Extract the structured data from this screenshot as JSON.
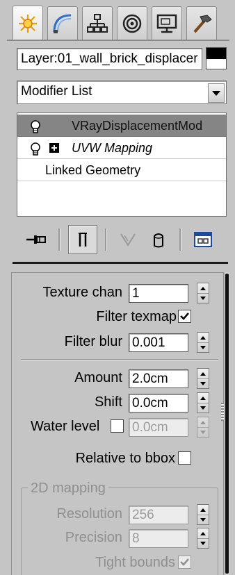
{
  "tabs": [
    {
      "name": "create-tab",
      "icon": "sun-icon",
      "active": true
    },
    {
      "name": "modify-tab",
      "icon": "modify-curve-icon",
      "active": false
    },
    {
      "name": "hierarchy-tab",
      "icon": "hierarchy-icon",
      "active": false
    },
    {
      "name": "motion-tab",
      "icon": "motion-circle-icon",
      "active": false
    },
    {
      "name": "display-tab",
      "icon": "monitor-icon",
      "active": false
    },
    {
      "name": "utilities-tab",
      "icon": "hammer-icon",
      "active": false
    }
  ],
  "object_name": "Layer:01_wall_brick_displacer",
  "object_color": "#000000",
  "modifier_list": {
    "selected": "Modifier List"
  },
  "modifier_stack": {
    "items": [
      {
        "label": "VRayDisplacementMod",
        "selected": true,
        "has_bulb": true,
        "expandable": false,
        "italic": false
      },
      {
        "label": "UVW Mapping",
        "selected": false,
        "has_bulb": true,
        "expandable": true,
        "italic": true
      },
      {
        "label": "Linked Geometry",
        "selected": false,
        "has_bulb": false,
        "expandable": false,
        "italic": false
      }
    ]
  },
  "stack_tools": [
    {
      "name": "pin-stack-button",
      "icon": "pin-icon"
    },
    {
      "name": "show-end-result-button",
      "icon": "end-result-icon"
    },
    {
      "name": "make-unique-button",
      "icon": "make-unique-icon"
    },
    {
      "name": "remove-modifier-button",
      "icon": "remove-modifier-icon"
    },
    {
      "name": "configure-modifier-sets-button",
      "icon": "configure-sets-icon"
    }
  ],
  "params": {
    "texture_chan": {
      "label": "Texture chan",
      "value": "1"
    },
    "filter_texmap": {
      "label": "Filter texmap",
      "checked": true
    },
    "filter_blur": {
      "label": "Filter blur",
      "value": "0.001"
    },
    "amount": {
      "label": "Amount",
      "value": "2.0cm"
    },
    "shift": {
      "label": "Shift",
      "value": "0.0cm"
    },
    "water_level": {
      "label": "Water level",
      "checked": false,
      "value": "0.0cm"
    },
    "relative_to_bbox": {
      "label": "Relative to bbox",
      "checked": false
    }
  },
  "mapping_2d": {
    "group_label": "2D mapping",
    "resolution": {
      "label": "Resolution",
      "value": "256"
    },
    "precision": {
      "label": "Precision",
      "value": "8"
    },
    "tight_bounds": {
      "label": "Tight bounds",
      "checked": true
    }
  }
}
